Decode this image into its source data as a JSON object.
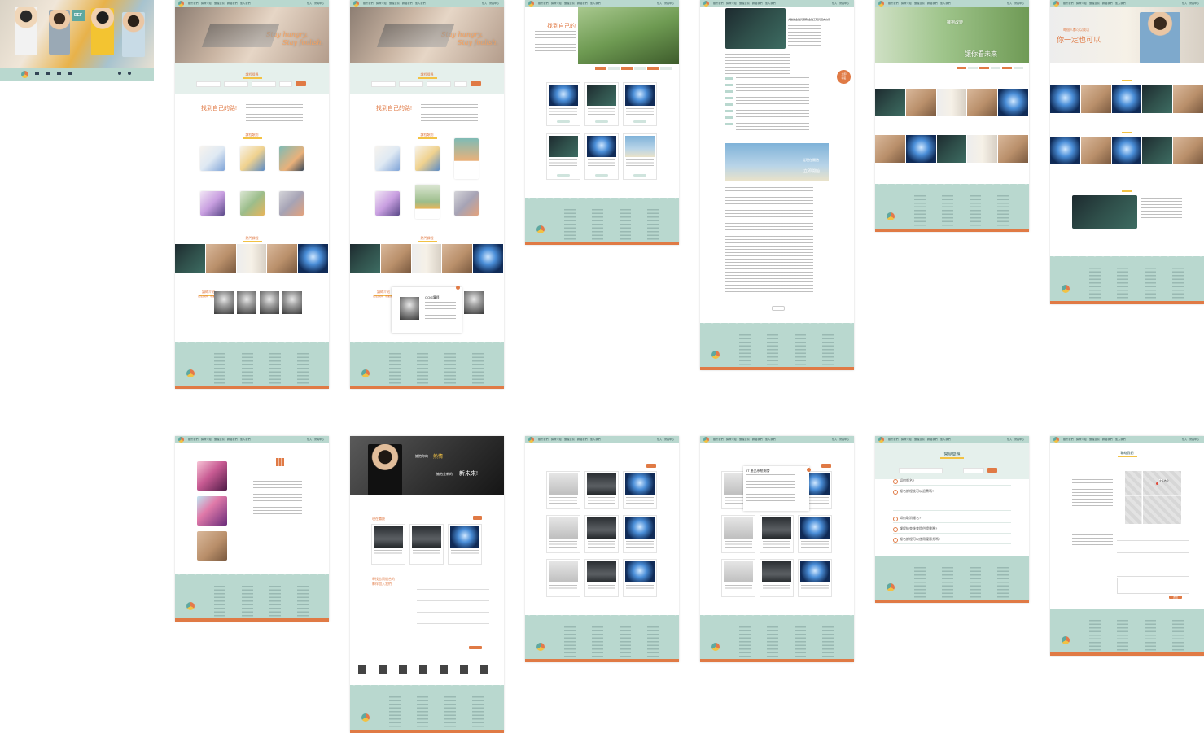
{
  "nav": {
    "links": "關於我們　講師介紹　課程資訊　聯絡我們　加入我們",
    "right_links": "登入　會員中心"
  },
  "thumb": {
    "badge": "DEF"
  },
  "home": {
    "hero_text_1": "Stay hungry,",
    "hero_text_2": "Stay foolish.",
    "section_search": "課程搜尋",
    "find_path": "找到自己的路!",
    "section_categories": "課程類別",
    "section_hot": "熱門課程",
    "section_teachers": "講師介紹",
    "teacher_subtitle": "最佳講師　專業首選",
    "popup_name": "OOO講師"
  },
  "courses": {
    "hero_title": "找到自己的",
    "course_titles": [
      "零基礎網頁前端開發",
      "大數據金融工程與程式交易",
      "從零開始學Python資料分析",
      "全端網頁開發實戰",
      "Unity遊戲開發入門",
      "商業數據分析與視覺化"
    ]
  },
  "detail": {
    "course_title": "大數據金融與實務-金融工程與程式交易",
    "cta_1": "立即",
    "cta_2": "報名",
    "banner_1": "從現在開始",
    "banner_2": "立即開始！"
  },
  "future": {
    "hero_text_1": "擁抱改變",
    "hero_text_2": "讓你看未來"
  },
  "career": {
    "hero_text_1": "每個人都可以成功",
    "hero_text_2": "你一定也可以"
  },
  "join": {
    "hero_text_1": "擁抱你的",
    "hero_text_2": "熱情",
    "hero_text_3": "擁抱全新的",
    "hero_text_4": "新未來!",
    "open_positions": "現在職缺",
    "apply_title_1": "尋找志同道合的",
    "apply_title_2": "夥伴加入我們"
  },
  "faq": {
    "title": "常見問題",
    "questions": [
      "如何報名?",
      "報名課程後可以退費嗎?",
      "如何取消報名?",
      "課程結束後會提供證書嗎?",
      "報名課程可以使用優惠券嗎?"
    ]
  },
  "contact": {
    "title": "聯絡我們",
    "map_label": "北區教室",
    "submit": "送出"
  },
  "popup2": {
    "title": "IT 產品系統開發"
  }
}
